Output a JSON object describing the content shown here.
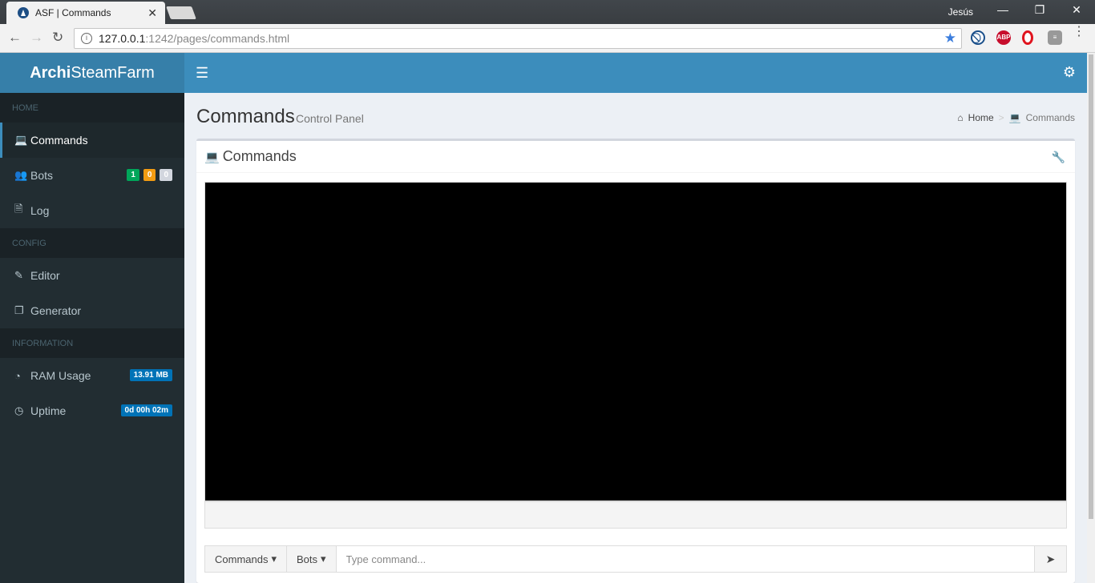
{
  "browser": {
    "tab_title": "ASF | Commands",
    "tab_close": "✕",
    "user": "Jesús",
    "url_host": "127.0.0.1",
    "url_rest": ":1242/pages/commands.html",
    "extensions": [
      {
        "name": "block-icon",
        "label": "⃠",
        "color": "#1a4f8a"
      },
      {
        "name": "adblock-plus-icon",
        "label": "ABP",
        "color": "#c70d2c"
      },
      {
        "name": "opera-icon",
        "label": "O",
        "color": "#e0141e"
      },
      {
        "name": "database-icon",
        "label": "≡",
        "color": "#777777"
      }
    ]
  },
  "app": {
    "logo_bold": "Archi",
    "logo_rest": "SteamFarm",
    "brand_color": "#3c8dbc"
  },
  "sidebar": {
    "sections": [
      {
        "header": "HOME"
      },
      {
        "header": "CONFIG"
      },
      {
        "header": "INFORMATION"
      }
    ],
    "items": {
      "commands": "Commands",
      "bots": "Bots",
      "log": "Log",
      "editor": "Editor",
      "generator": "Generator",
      "ram": "RAM Usage",
      "uptime": "Uptime"
    },
    "bot_badges": [
      {
        "value": "1",
        "color": "#00a65a"
      },
      {
        "value": "0",
        "color": "#f39c12"
      },
      {
        "value": "0",
        "color": "#d2d6de"
      }
    ],
    "ram_value": "13.91 MB",
    "uptime_value": "0d 00h 02m",
    "info_badge_color": "#0073b7"
  },
  "content": {
    "title": "Commands",
    "subtitle": "Control Panel",
    "breadcrumb_home": "Home",
    "breadcrumb_current": "Commands",
    "box_title": "Commands",
    "commands_dropdown": "Commands",
    "bots_dropdown": "Bots",
    "input_placeholder": "Type command..."
  }
}
